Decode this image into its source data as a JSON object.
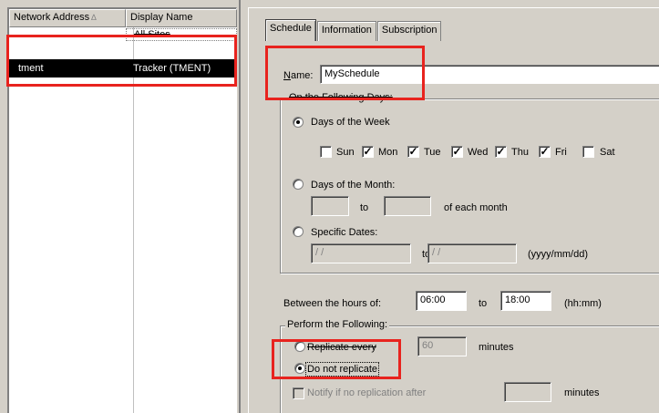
{
  "list": {
    "columns": [
      {
        "label": "Network Address",
        "sort_icon": "sort-ascending-icon"
      },
      {
        "label": "Display Name"
      }
    ],
    "rows": [
      {
        "address": "",
        "display_name": "All Sites"
      },
      {
        "address": "tment",
        "display_name": "Tracker (TMENT)"
      }
    ]
  },
  "tabs": [
    {
      "label": "Schedule"
    },
    {
      "label": "Information"
    },
    {
      "label": "Subscription"
    }
  ],
  "schedule": {
    "name_label": "Name:",
    "name_value": "MySchedule",
    "days_group_title": "On the Following Days:",
    "days_of_week_label": "Days of the Week",
    "weekdays": [
      {
        "label": "Sun",
        "checked": false
      },
      {
        "label": "Mon",
        "checked": true
      },
      {
        "label": "Tue",
        "checked": true
      },
      {
        "label": "Wed",
        "checked": true
      },
      {
        "label": "Thu",
        "checked": true
      },
      {
        "label": "Fri",
        "checked": true
      },
      {
        "label": "Sat",
        "checked": false
      }
    ],
    "days_of_month_label": "Days of the Month:",
    "to_label": "to",
    "each_month_label": "of each month",
    "specific_dates_label": "Specific Dates:",
    "date_from": "/ /",
    "date_to": "/ /",
    "date_format_label": "(yyyy/mm/dd)",
    "between_hours_label": "Between the hours of:",
    "start_time": "06:00",
    "end_time": "18:00",
    "time_format_label": "(hh:mm)",
    "perform_group_title": "Perform the Following:",
    "replicate_every_label": "Replicate every",
    "replicate_value": "60",
    "minutes_label": "minutes",
    "do_not_replicate_label": "Do not replicate",
    "notify_label": "Notify if no replication after",
    "notify_minutes_label": "minutes"
  },
  "colors": {
    "highlight": "#e8231e",
    "selection": "#000000",
    "window": "#d4d0c8"
  }
}
